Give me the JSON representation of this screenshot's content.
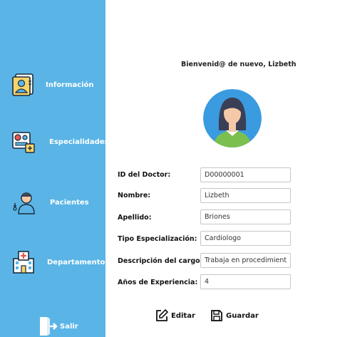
{
  "sidebar": {
    "items": [
      {
        "label": "Información",
        "icon": "doctor-profile-icon"
      },
      {
        "label": "Especialidades",
        "icon": "medical-kit-icon"
      },
      {
        "label": "Pacientes",
        "icon": "patient-icon"
      },
      {
        "label": "Departamento",
        "icon": "hospital-icon"
      }
    ],
    "logout_label": "Salir"
  },
  "main": {
    "welcome": "Bienvenid@ de nuevo, Lizbeth",
    "fields": [
      {
        "label": "ID del Doctor:",
        "value": "D00000001"
      },
      {
        "label": "Nombre:",
        "value": "Lizbeth"
      },
      {
        "label": "Apellido:",
        "value": "Briones"
      },
      {
        "label": "Tipo Especialización:",
        "value": "Cardiologo"
      },
      {
        "label": "Descripción del cargo:",
        "value": "Trabaja en procedimientc"
      },
      {
        "label": "Años de Experiencia:",
        "value": "4"
      }
    ],
    "edit_label": "Editar",
    "save_label": "Guardar"
  },
  "colors": {
    "sidebar": "#5ab5e6",
    "avatar_bg": "#3a9be0",
    "shirt": "#7bbf4f",
    "hair": "#3b3f56",
    "skin": "#f4c9a8"
  }
}
